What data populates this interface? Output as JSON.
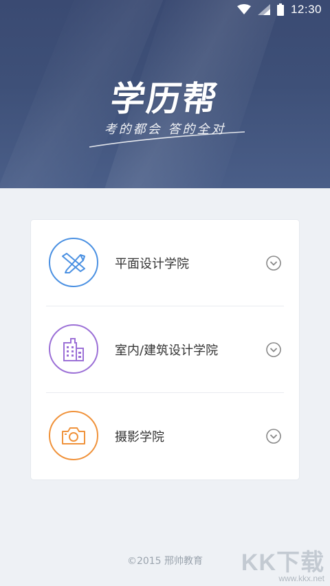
{
  "status_bar": {
    "time": "12:30"
  },
  "header": {
    "logo_title": "学历帮",
    "slogan": "考的都会 答的全对"
  },
  "colleges": [
    {
      "label": "平面设计学院",
      "icon": "pencil-ruler-icon",
      "color": "#4a90e2"
    },
    {
      "label": "室内/建筑设计学院",
      "icon": "building-icon",
      "color": "#9b6fd6"
    },
    {
      "label": "摄影学院",
      "icon": "camera-icon",
      "color": "#f0923a"
    }
  ],
  "footer": {
    "copyright": "©2015 邢帅教育"
  },
  "watermark": {
    "brand": "KK下载",
    "url": "www.kkx.net"
  }
}
